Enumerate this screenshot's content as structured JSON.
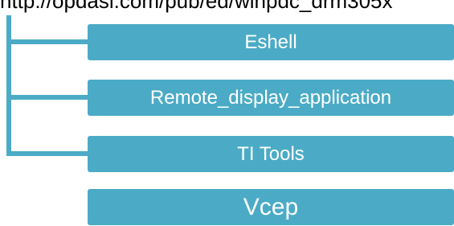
{
  "header": {
    "path_text": "http://opdasl.com/pub/ed/winpdc_drm305x"
  },
  "tree": {
    "color": "#4babc6",
    "nodes": [
      {
        "label": "Eshell"
      },
      {
        "label": "Remote_display_application"
      },
      {
        "label": "TI Tools"
      },
      {
        "label": "Vcep"
      }
    ]
  }
}
